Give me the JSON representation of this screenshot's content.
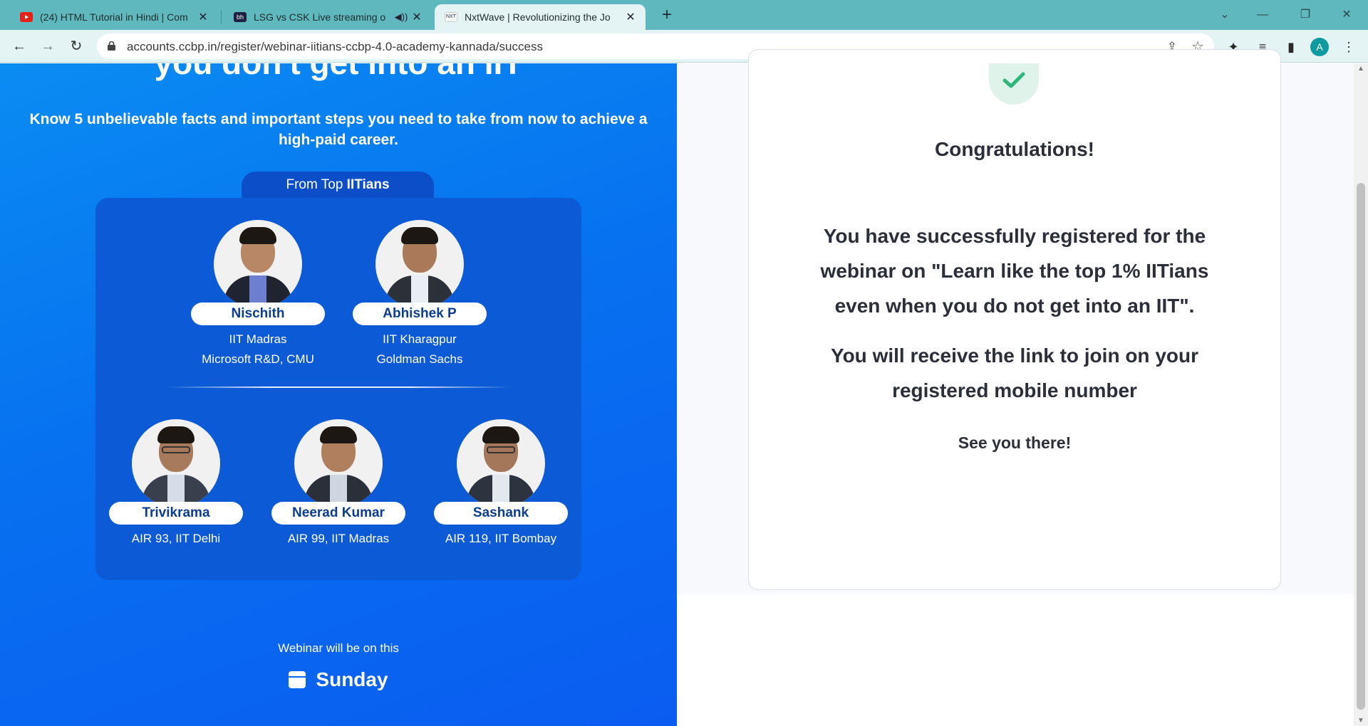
{
  "browser": {
    "tabs": [
      {
        "title": "(24) HTML Tutorial in Hindi | Com",
        "favicon": "youtube-icon",
        "active": false
      },
      {
        "title": "LSG vs CSK Live streaming o",
        "favicon": "sports-site-icon",
        "active": false
      },
      {
        "title": "NxtWave | Revolutionizing the Jo",
        "favicon": "nxtwave-icon",
        "active": true
      }
    ],
    "url": "accounts.ccbp.in/register/webinar-iitians-ccbp-4.0-academy-kannada/success",
    "profile_initial": "A"
  },
  "hero": {
    "title_fragment": "you don't get into an IIT",
    "subtitle": "Know 5 unbelievable facts and important steps you need to take from now to achieve a high-paid career."
  },
  "mentors_section": {
    "label_prefix": "From Top ",
    "label_bold": "IITians",
    "top_row": [
      {
        "name": "Nischith",
        "line1": "IIT Madras",
        "line2": "Microsoft R&D, CMU"
      },
      {
        "name": "Abhishek P",
        "line1": "IIT Kharagpur",
        "line2": "Goldman Sachs"
      }
    ],
    "bottom_row": [
      {
        "name": "Trivikrama",
        "line1": "AIR 93, IIT Delhi"
      },
      {
        "name": "Neerad Kumar",
        "line1": "AIR 99, IIT Madras"
      },
      {
        "name": "Sashank",
        "line1": "AIR 119, IIT Bombay"
      }
    ]
  },
  "webinar": {
    "on_label": "Webinar will be on this",
    "day": "Sunday"
  },
  "success": {
    "heading": "Congratulations!",
    "message": "You have successfully registered for the webinar on \"Learn like the top 1% IITians even when you do not get into an IIT\".",
    "link_info": "You will receive the link to join on your registered mobile number",
    "closing": "See you there!"
  },
  "colors": {
    "left_panel_blue": "#0a6ef0",
    "card_blue": "#0c5ad6",
    "success_green": "#2fb67a",
    "tab_strip": "#5fb8bd"
  }
}
